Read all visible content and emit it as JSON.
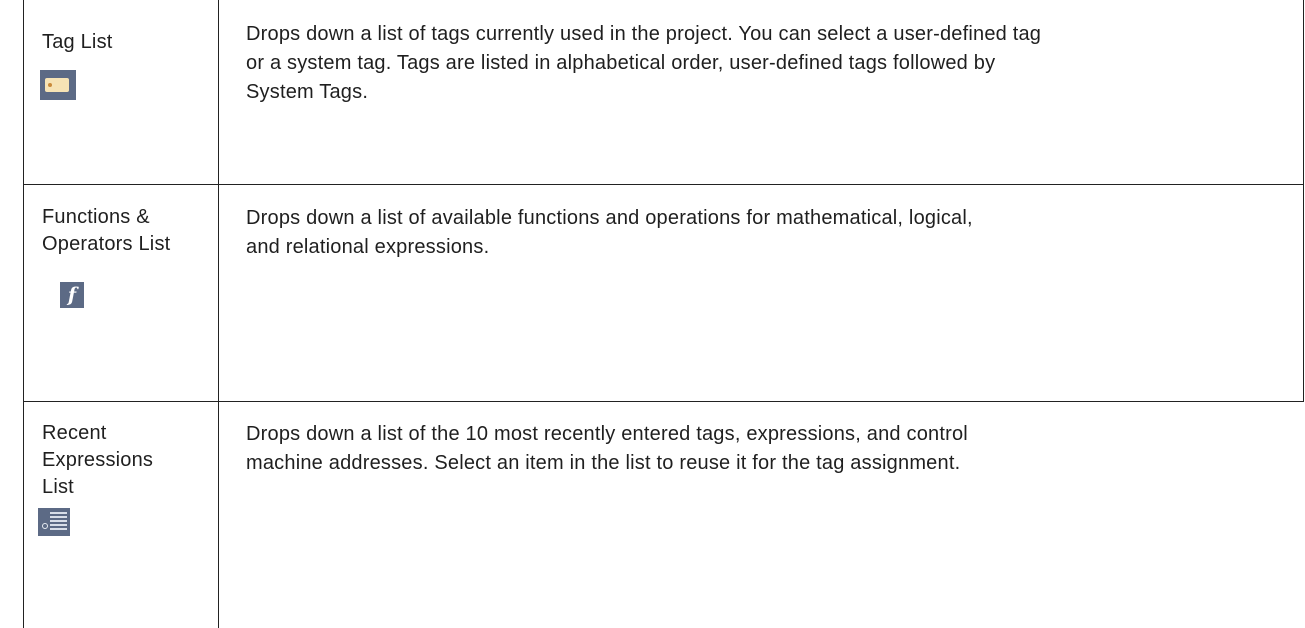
{
  "rows": [
    {
      "label": "Tag List",
      "icon": "tag-icon",
      "description_lines": [
        "Drops down a list of tags currently used in the project.  You can select a user-defined tag",
        "or a system tag.  Tags are listed in alphabetical order, user-defined tags followed by",
        "System Tags."
      ]
    },
    {
      "label": "Functions &\nOperators List",
      "icon": "function-icon",
      "icon_glyph": "f",
      "description_lines": [
        "Drops down a list of available functions and operations for mathematical, logical,",
        "and relational expressions."
      ]
    },
    {
      "label": "Recent\nExpressions\nList",
      "icon": "recent-list-icon",
      "description_lines": [
        "Drops down a list of the 10 most recently entered tags, expressions, and control",
        "machine addresses.  Select an item in the list to reuse it for the tag assignment."
      ]
    }
  ],
  "colors": {
    "icon_background": "#5c6a85",
    "tag_fill": "#f6e3b5",
    "border": "#222222"
  }
}
